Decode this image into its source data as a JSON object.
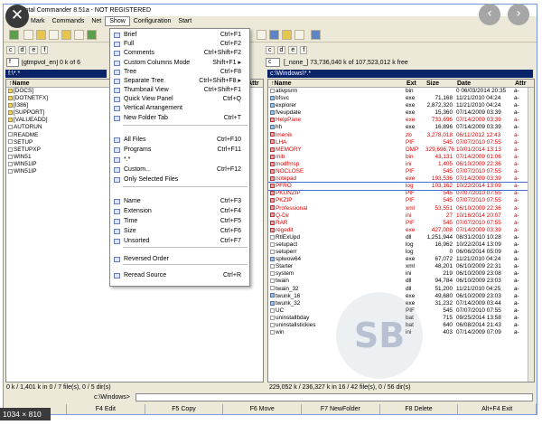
{
  "window": {
    "title": "Total Commander 8.51a - NOT REGISTERED"
  },
  "menu": [
    "Mark",
    "Commands",
    "Net",
    "Show",
    "Configuration",
    "Start"
  ],
  "show_menu": [
    {
      "label": "Brief",
      "shortcut": "Ctrl+F1"
    },
    {
      "label": "Full",
      "shortcut": "Ctrl+F2"
    },
    {
      "label": "Comments",
      "shortcut": "Ctrl+Shift+F2"
    },
    {
      "label": "Custom Columns Mode",
      "shortcut": "Shift+F1 ▸"
    },
    {
      "label": "Tree",
      "shortcut": "Ctrl+F8"
    },
    {
      "label": "Separate Tree",
      "shortcut": "Ctrl+Shift+F8 ▸"
    },
    {
      "label": "Thumbnail View",
      "shortcut": "Ctrl+Shift+F1"
    },
    {
      "label": "Quick View Panel",
      "shortcut": "Ctrl+Q"
    },
    {
      "label": "Vertical Arrangement",
      "shortcut": ""
    },
    {
      "label": "New Folder Tab",
      "shortcut": "Ctrl+T"
    },
    {
      "label": "All Files",
      "shortcut": "Ctrl+F10"
    },
    {
      "label": "Programs",
      "shortcut": "Ctrl+F11"
    },
    {
      "label": "*.*",
      "shortcut": ""
    },
    {
      "label": "Custom...",
      "shortcut": "Ctrl+F12"
    },
    {
      "label": "Only Selected Files",
      "shortcut": ""
    },
    {
      "label": "Name",
      "shortcut": "Ctrl+F3"
    },
    {
      "label": "Extension",
      "shortcut": "Ctrl+F4"
    },
    {
      "label": "Time",
      "shortcut": "Ctrl+F5"
    },
    {
      "label": "Size",
      "shortcut": "Ctrl+F6"
    },
    {
      "label": "Unsorted",
      "shortcut": "Ctrl+F7"
    },
    {
      "label": "Reversed Order",
      "shortcut": ""
    },
    {
      "label": "Reread Source",
      "shortcut": "Ctrl+R"
    }
  ],
  "left_panel": {
    "drive": "f",
    "drive_info": "[gtmpvol_en]  0 k of 6",
    "path": "f:\\*.*",
    "header": {
      "name": "↑Name",
      "attr": "Attr"
    },
    "rows": [
      "[DOCS]",
      "[DOTNETFX]",
      "[I386]",
      "[SUPPORT]",
      "[VALUEADD]",
      "AUTORUN",
      "README",
      "SETUP",
      "SETUPXP",
      "WIN51",
      "WIN51IP",
      "WIN51IP"
    ],
    "status": "0 k / 1,401 k in 0 / 7 file(s), 0 / 5 dir(s)"
  },
  "right_panel": {
    "drive": "c",
    "drive_info": "[_none_]  73,736,040 k of 107,523,012 k free",
    "path": "c:\\Windows\\*.*",
    "header": {
      "name": "↑Name",
      "ext": "Ext",
      "size": "Size",
      "date": "Date",
      "attr": "Attr"
    },
    "rows": [
      {
        "name": "ativpsrm",
        "ext": "bin",
        "size": "",
        "date": "0 06/03/2014 20:35",
        "attr": "a-",
        "color": "#000000",
        "icon": "txt"
      },
      {
        "name": "bfsvc",
        "ext": "exe",
        "size": "71,168",
        "date": "11/21/2010 04:24",
        "attr": "a-",
        "color": "#000000",
        "icon": "exe"
      },
      {
        "name": "explorer",
        "ext": "exe",
        "size": "2,872,320",
        "date": "11/21/2010 04:24",
        "attr": "a-",
        "color": "#000000",
        "icon": "exe"
      },
      {
        "name": "fveupdate",
        "ext": "exe",
        "size": "15,360",
        "date": "07/14/2009 03:39",
        "attr": "a-",
        "color": "#000000",
        "icon": "exe"
      },
      {
        "name": "HelpPane",
        "ext": "exe",
        "size": "733,696",
        "date": "07/14/2009 03:39",
        "attr": "a-",
        "color": "#e00000",
        "icon": "red"
      },
      {
        "name": "hh",
        "ext": "exe",
        "size": "16,896",
        "date": "07/14/2009 03:39",
        "attr": "a-",
        "color": "#000000",
        "icon": "exe"
      },
      {
        "name": "lmenik",
        "ext": "zb",
        "size": "3,278,018",
        "date": "06/11/2012 12:43",
        "attr": "a-",
        "color": "#e00000",
        "icon": "red"
      },
      {
        "name": "LHA",
        "ext": "PIF",
        "size": "545",
        "date": "07/07/2010 07:55",
        "attr": "a-",
        "color": "#e00000",
        "icon": "red"
      },
      {
        "name": "MEMORY",
        "ext": "DMP",
        "size": "329,696,766",
        "date": "10/01/2014 13:13",
        "attr": "a-",
        "color": "#e00000",
        "icon": "red"
      },
      {
        "name": "mib",
        "ext": "bin",
        "size": "43,131",
        "date": "07/14/2009 01:06",
        "attr": "a-",
        "color": "#e00000",
        "icon": "red"
      },
      {
        "name": "modfmsp",
        "ext": "ini",
        "size": "1,405",
        "date": "06/10/2009 22:36",
        "attr": "a-",
        "color": "#e00000",
        "icon": "red"
      },
      {
        "name": "NOCLOSE",
        "ext": "PIF",
        "size": "545",
        "date": "07/07/2010 07:55",
        "attr": "a-",
        "color": "#e00000",
        "icon": "red"
      },
      {
        "name": "notepad",
        "ext": "exe",
        "size": "193,536",
        "date": "07/14/2009 03:39",
        "attr": "a-",
        "color": "#e00000",
        "icon": "red"
      },
      {
        "name": "PFRO",
        "ext": "log",
        "size": "103,162",
        "date": "10/22/2014 13:09",
        "attr": "a-",
        "color": "#e00000",
        "icon": "red"
      },
      {
        "name": "PKUNZIP",
        "ext": "PIF",
        "size": "545",
        "date": "07/07/2010 07:55",
        "attr": "a-",
        "color": "#e00000",
        "icon": "red"
      },
      {
        "name": "PKZIP",
        "ext": "PIF",
        "size": "545",
        "date": "07/07/2010 07:55",
        "attr": "a-",
        "color": "#e00000",
        "icon": "red"
      },
      {
        "name": "Professional",
        "ext": "xml",
        "size": "53,551",
        "date": "06/10/2009 22:36",
        "attr": "a-",
        "color": "#e00000",
        "icon": "red"
      },
      {
        "name": "Q-Dir",
        "ext": "ini",
        "size": "27",
        "date": "10/16/2014 20:07",
        "attr": "a-",
        "color": "#e00000",
        "icon": "red"
      },
      {
        "name": "RAR",
        "ext": "PIF",
        "size": "545",
        "date": "07/07/2010 07:55",
        "attr": "a-",
        "color": "#e00000",
        "icon": "red"
      },
      {
        "name": "regedit",
        "ext": "exe",
        "size": "427,008",
        "date": "07/14/2009 03:39",
        "attr": "a-",
        "color": "#e00000",
        "icon": "red"
      },
      {
        "name": "RtlExUpd",
        "ext": "dll",
        "size": "1,251,944",
        "date": "08/31/2010 10:28",
        "attr": "a-",
        "color": "#000000",
        "icon": "txt"
      },
      {
        "name": "setupact",
        "ext": "log",
        "size": "16,962",
        "date": "10/22/2014 13:09",
        "attr": "a-",
        "color": "#000000",
        "icon": "txt"
      },
      {
        "name": "setuperr",
        "ext": "log",
        "size": "0",
        "date": "06/06/2014 05:09",
        "attr": "a-",
        "color": "#000000",
        "icon": "txt"
      },
      {
        "name": "splwow64",
        "ext": "exe",
        "size": "67,072",
        "date": "11/21/2010 04:24",
        "attr": "a-",
        "color": "#000000",
        "icon": "exe"
      },
      {
        "name": "Starter",
        "ext": "xml",
        "size": "48,201",
        "date": "06/10/2009 22:31",
        "attr": "a-",
        "color": "#000000",
        "icon": "txt"
      },
      {
        "name": "system",
        "ext": "ini",
        "size": "219",
        "date": "06/10/2009 23:08",
        "attr": "a-",
        "color": "#000000",
        "icon": "txt"
      },
      {
        "name": "twain",
        "ext": "dll",
        "size": "94,784",
        "date": "06/10/2009 23:03",
        "attr": "a-",
        "color": "#000000",
        "icon": "txt"
      },
      {
        "name": "twain_32",
        "ext": "dll",
        "size": "51,200",
        "date": "11/21/2010 04:25",
        "attr": "a-",
        "color": "#000000",
        "icon": "txt"
      },
      {
        "name": "twunk_16",
        "ext": "exe",
        "size": "49,680",
        "date": "06/10/2009 23:03",
        "attr": "a-",
        "color": "#000000",
        "icon": "exe"
      },
      {
        "name": "twunk_32",
        "ext": "exe",
        "size": "31,232",
        "date": "07/14/2009 03:44",
        "attr": "a-",
        "color": "#000000",
        "icon": "exe"
      },
      {
        "name": "UC",
        "ext": "PIF",
        "size": "545",
        "date": "07/07/2010 07:55",
        "attr": "a-",
        "color": "#000000",
        "icon": "txt"
      },
      {
        "name": "uninstallbday",
        "ext": "bat",
        "size": "715",
        "date": "09/25/2014 13:58",
        "attr": "a-",
        "color": "#000000",
        "icon": "txt"
      },
      {
        "name": "uninstallstickies",
        "ext": "bat",
        "size": "640",
        "date": "06/08/2014 21:43",
        "attr": "a-",
        "color": "#000000",
        "icon": "txt"
      },
      {
        "name": "win",
        "ext": "ini",
        "size": "403",
        "date": "07/14/2009 07:09",
        "attr": "a-",
        "color": "#000000",
        "icon": "txt"
      }
    ],
    "status": "229,052 k / 236,327 k in 16 / 42 file(s), 0 / 56 dir(s)"
  },
  "command_line": {
    "path": "c:\\Windows>"
  },
  "function_keys": [
    "F4 Edit",
    "F5 Copy",
    "F6 Move",
    "F7 NewFolder",
    "F8 Delete",
    "Alt+F4 Exit"
  ],
  "overlay": {
    "dimensions": "1034 × 810",
    "close": "✕",
    "prev": "‹",
    "next": "›",
    "watermark": "SB"
  }
}
